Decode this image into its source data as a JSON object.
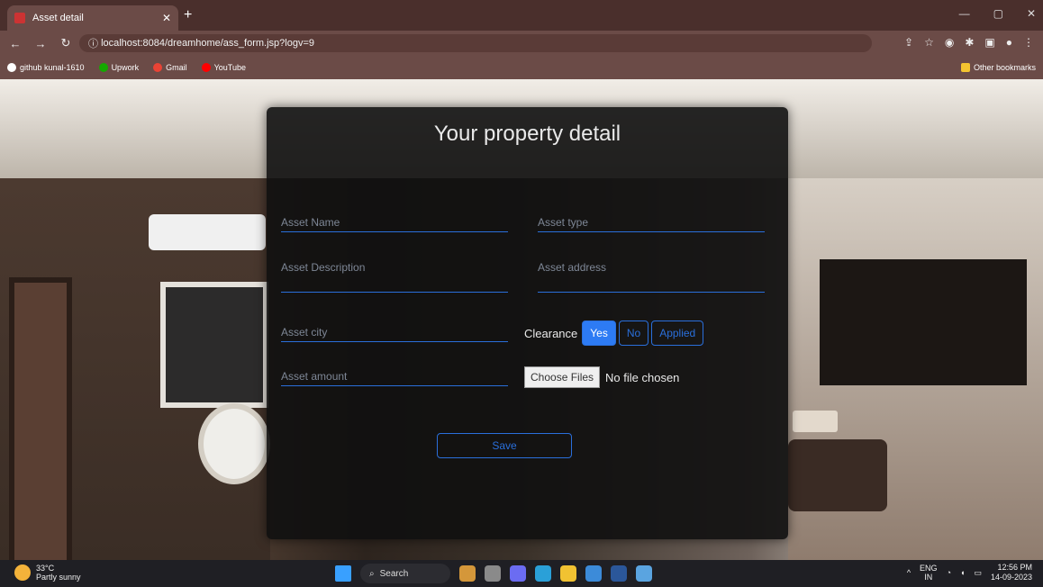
{
  "browser": {
    "tab_title": "Asset detail",
    "url": "localhost:8084/dreamhome/ass_form.jsp?logv=9",
    "bookmarks": [
      "github kunal-1610",
      "Upwork",
      "Gmail",
      "YouTube"
    ],
    "other_bookmarks": "Other bookmarks"
  },
  "form": {
    "title": "Your property detail",
    "asset_name_placeholder": "Asset Name",
    "asset_type_placeholder": "Asset type",
    "asset_description_placeholder": "Asset Description",
    "asset_address_placeholder": "Asset address",
    "asset_city_placeholder": "Asset city",
    "asset_amount_placeholder": "Asset amount",
    "clearance_label": "Clearance",
    "clearance_options": [
      "Yes",
      "No",
      "Applied"
    ],
    "clearance_selected": "Yes",
    "choose_files_label": "Choose Files",
    "no_file_text": "No file chosen",
    "save_label": "Save"
  },
  "taskbar": {
    "temperature": "33°C",
    "weather": "Partly sunny",
    "search": "Search",
    "lang": "ENG",
    "region": "IN",
    "time": "12:56 PM",
    "date": "14-09-2023"
  },
  "colors": {
    "accent": "#2d7bf4",
    "panel_bg": "#0f0f0f",
    "browser_bg": "#6b4b47"
  }
}
